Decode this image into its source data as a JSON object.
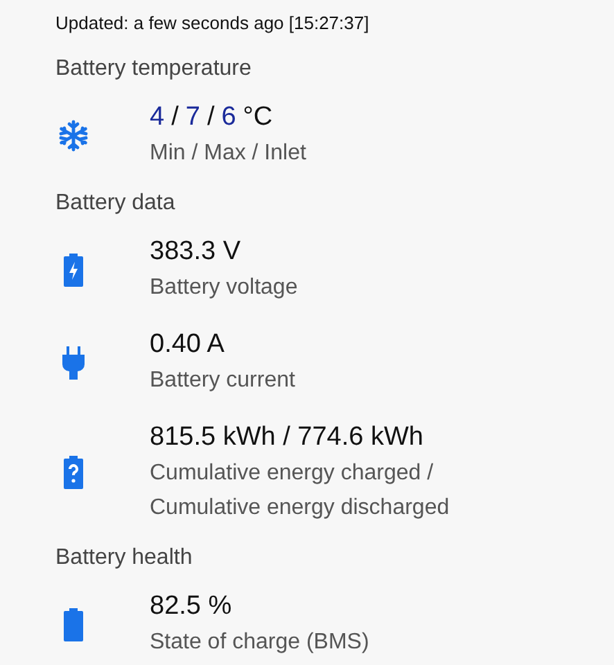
{
  "updated": "Updated: a few seconds ago [15:27:37]",
  "sections": [
    {
      "title": "Battery temperature",
      "rows": [
        {
          "kind": "snowflake",
          "value_parts": [
            {
              "kind": "reading",
              "text": "4"
            },
            {
              "kind": "plain",
              "text": "/"
            },
            {
              "kind": "reading",
              "text": "7"
            },
            {
              "kind": "plain",
              "text": "/"
            },
            {
              "kind": "reading",
              "text": "6"
            },
            {
              "kind": "plain",
              "text": "°C"
            }
          ],
          "subtitle": [
            "Min / Max / Inlet"
          ]
        }
      ]
    },
    {
      "title": "Battery data",
      "rows": [
        {
          "kind": "charging",
          "value": "383.3 V",
          "subtitle": [
            "Battery voltage"
          ]
        },
        {
          "kind": "plug",
          "value": "0.40 A",
          "subtitle": [
            "Battery current"
          ]
        },
        {
          "kind": "unknown",
          "value": "815.5 kWh / 774.6 kWh",
          "subtitle": [
            "Cumulative energy charged /",
            "Cumulative energy discharged"
          ]
        }
      ]
    },
    {
      "title": "Battery health",
      "rows": [
        {
          "kind": "battery",
          "value": "82.5 %",
          "subtitle": [
            "State of charge (BMS)"
          ]
        }
      ]
    }
  ]
}
